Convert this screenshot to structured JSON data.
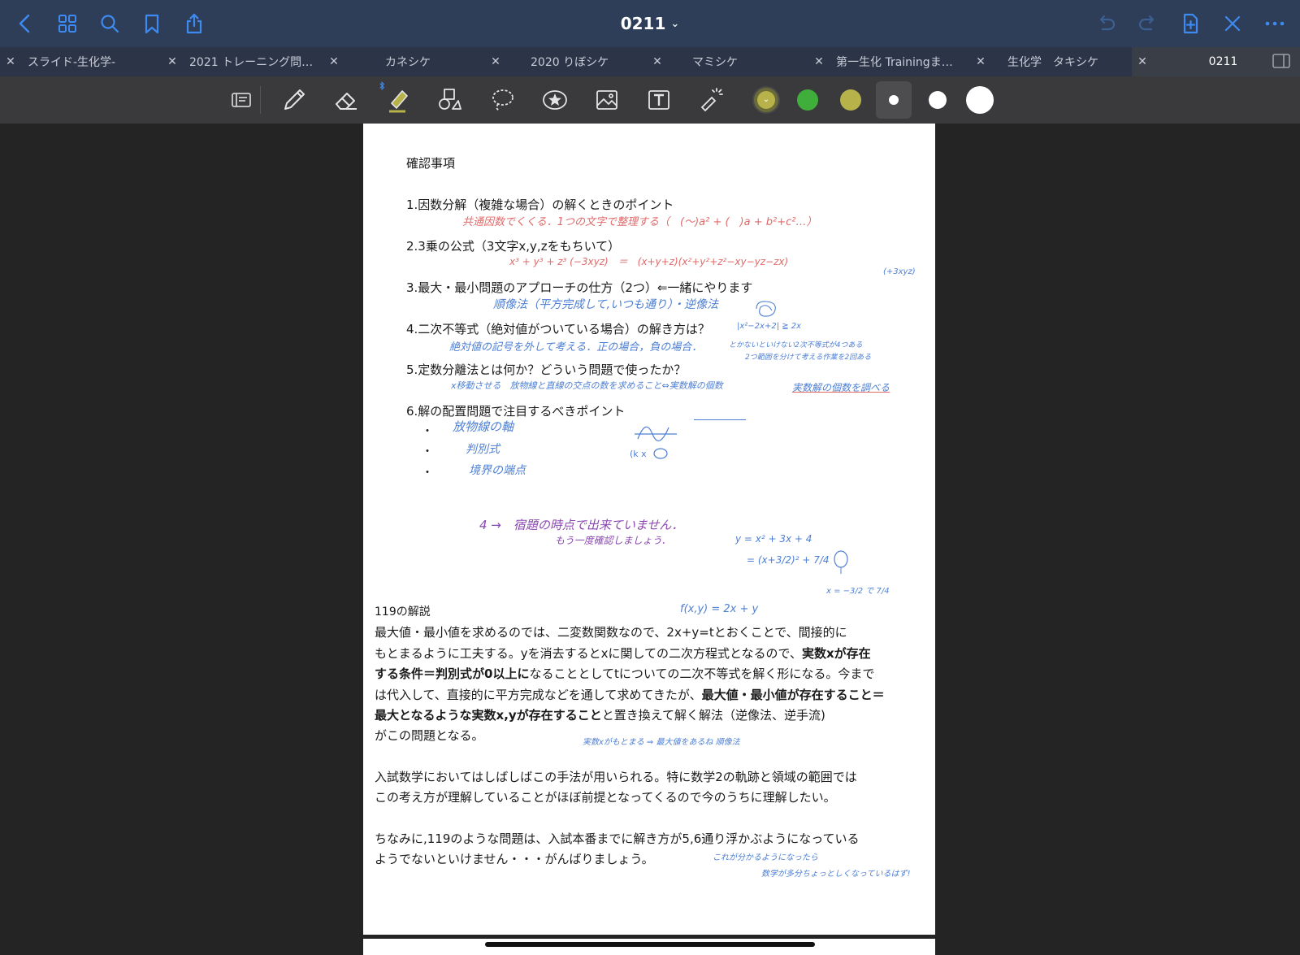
{
  "header": {
    "title": "0211"
  },
  "tabs": [
    {
      "label": "スライド-生化学-"
    },
    {
      "label": "2021 トレーニング問…"
    },
    {
      "label": "カネシケ"
    },
    {
      "label": "2020 りぼシケ"
    },
    {
      "label": "マミシケ"
    },
    {
      "label": "第一生化 Trainingま…"
    },
    {
      "label": "生化学　タキシケ"
    },
    {
      "label": "0211"
    }
  ],
  "colors": {
    "accent": "#2f80ed",
    "topbar": "#2f3e58",
    "toolbar": "#3a3a3c",
    "swatch_olive": "#b7b34a",
    "swatch_green": "#3fae3b",
    "ink_red": "#e06a6a",
    "ink_blue": "#4d7fd4",
    "ink_purple": "#8b47b2"
  },
  "document": {
    "heading": "確認事項",
    "items": [
      "1.因数分解（複雑な場合）の解くときのポイント",
      "2.3乗の公式（3文字x,y,zをもちいて）",
      "3.最大・最小問題のアプローチの仕方（2つ）⇐一緒にやります",
      "4.二次不等式（絶対値がついている場合）の解き方は？",
      "5.定数分離法とは何か？どういう問題で使ったか？",
      "6.解の配置問題で注目するべきポイント"
    ],
    "bullets": [
      "・",
      "・",
      "・"
    ],
    "section_title": "119の解説",
    "para1": {
      "l1": "最大値・最小値を求めるのでは、二変数関数なので、2x+y=tとおくことで、間接的に",
      "l2a": "もとまるように工夫する。yを消去するとxに関しての二次方程式となるので、",
      "l2b": "実数xが存在",
      "l3a": "する条件＝判別式が0以上に",
      "l3b": "なることとしてtについての二次不等式を解く形になる。今まで",
      "l4a": "は代入して、直接的に平方完成などを通して求めてきたが、",
      "l4b": "最大値・最小値が存在すること＝",
      "l5a": "最大となるような実数x,yが存在すること",
      "l5b": "と置き換えて解く解法（逆像法、逆手流)",
      "l6": "がこの問題となる。"
    },
    "para2": {
      "l1": "入試数学においてはしばしばこの手法が用いられる。特に数学2の軌跡と領域の範囲では",
      "l2": "この考え方が理解していることがほぼ前提となってくるので今のうちに理解したい。"
    },
    "para3": {
      "l1": "ちなみに,119のような問題は、入試本番までに解き方が5,6通り浮かぶようになっている",
      "l2": "ようでないといけません・・・がんばりましょう。"
    }
  },
  "handwriting": {
    "n1": "共通因数でくくる．1つの文字で整理する（　(〜)a² + (　)a + b²+c²…）",
    "n2": "x³ + y³ + z³ (−3xyz)　＝　(x+y+z)(x²+y²+z²−xy−yz−zx)",
    "n2b": "(+3xyz)",
    "n3": "順像法（平方完成して,いつも通り）・逆像法",
    "n4a": "|x²−2x+2| ≧ 2x",
    "n4": "絶対値の記号を外して考える．正の場合，負の場合．",
    "n4b": "とかないといけない2次不等式が4つある",
    "n4c": "2つ範囲を分けて考える作業を2回ある",
    "n5": "x移動させる　放物線と直線の交点の数を求めること⇔実数解の個数",
    "n5b": "実数解の個数を調べる",
    "n6a": "放物線の軸",
    "n6b": "判別式",
    "n6c": "境界の端点",
    "n7": "4 →　宿題の時点で出来ていません．",
    "n7b": "もう一度確認しましょう．",
    "n8a": "y = x² + 3x + 4",
    "n8b": "= (x+3/2)² + 7/4",
    "n8c": "x = −3/2 で 7/4",
    "n9": "f(x,y) = 2x + y",
    "n10": "実数xがもとまる ⇒ 最大値をあるね 順像法",
    "n11a": "これが分かるようになったら",
    "n11b": "数学が多分ちょっとしくなっているはず!"
  }
}
